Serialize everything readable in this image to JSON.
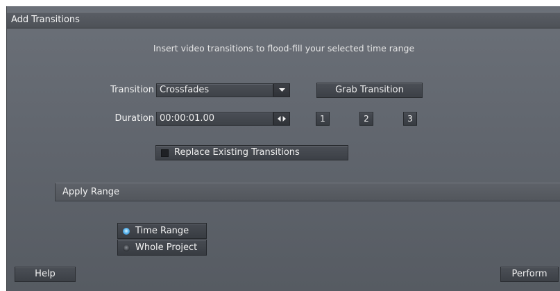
{
  "dialog": {
    "title": "Add Transitions",
    "subtitle": "Insert video transitions to flood-fill your selected time range"
  },
  "transition": {
    "label": "Transition",
    "value": "Crossfades",
    "dropdown_icon": "chevron-down-icon",
    "grab_label": "Grab Transition"
  },
  "duration": {
    "label": "Duration",
    "value": "00:00:01.00",
    "stepper_icon": "left-right-arrows-icon",
    "presets": [
      "1",
      "2",
      "3"
    ]
  },
  "replace": {
    "label": "Replace Existing Transitions",
    "checked": false
  },
  "apply_range": {
    "title": "Apply Range",
    "options": [
      {
        "label": "Time Range",
        "selected": true
      },
      {
        "label": "Whole Project",
        "selected": false
      }
    ]
  },
  "footer": {
    "help_label": "Help",
    "perform_label": "Perform"
  },
  "colors": {
    "panel": "#60656d",
    "titlebar": "#4d5157",
    "radio_selected": "#5fb8ee"
  }
}
